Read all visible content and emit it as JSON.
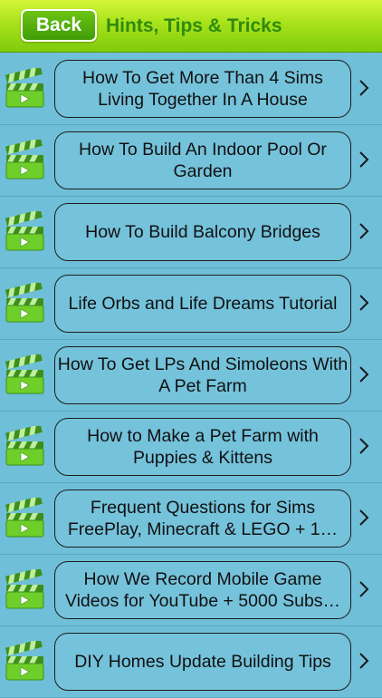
{
  "header": {
    "back_label": "Back",
    "title": "Hints, Tips & Tricks"
  },
  "colors": {
    "header_top": "#d4f53a",
    "header_bottom": "#7fcb0c",
    "title": "#2f8a0e",
    "back_button": "#4aa80a",
    "list_background": "#6fbfd8",
    "clapperboard": "#6fcf2a"
  },
  "list": {
    "items": [
      {
        "label": "How To Get More Than 4 Sims Living Together In A House",
        "icon": "clapperboard-icon"
      },
      {
        "label": "How To Build An Indoor Pool Or Garden",
        "icon": "clapperboard-icon"
      },
      {
        "label": "How To Build Balcony Bridges",
        "icon": "clapperboard-icon"
      },
      {
        "label": "Life Orbs and Life Dreams Tutorial",
        "icon": "clapperboard-icon"
      },
      {
        "label": "How To Get LPs And Simoleons With A Pet Farm",
        "icon": "clapperboard-icon"
      },
      {
        "label": "How to Make a Pet Farm with Puppies & Kittens",
        "icon": "clapperboard-icon"
      },
      {
        "label": "Frequent Questions for Sims FreePlay, Minecraft & LEGO + 1…",
        "icon": "clapperboard-icon"
      },
      {
        "label": "How We Record Mobile Game Videos for YouTube + 5000 Subs…",
        "icon": "clapperboard-icon"
      },
      {
        "label": "DIY Homes Update Building Tips",
        "icon": "clapperboard-icon"
      }
    ]
  }
}
